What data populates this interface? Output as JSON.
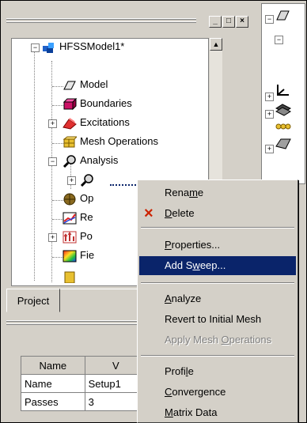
{
  "window": {
    "min_glyph": "_",
    "max_glyph": "□",
    "close_glyph": "×"
  },
  "tree": {
    "root": {
      "label": "HFSSModel1*",
      "icon": "hfss-model-icon",
      "expander": "−"
    },
    "items": [
      {
        "label": "Model",
        "icon": "model-icon"
      },
      {
        "label": "Boundaries",
        "icon": "boundaries-icon"
      },
      {
        "label": "Excitations",
        "icon": "excitations-icon",
        "expander": "+"
      },
      {
        "label": "Mesh Operations",
        "icon": "mesh-operations-icon"
      },
      {
        "label": "Analysis",
        "icon": "analysis-icon",
        "expander": "−"
      },
      {
        "label": "",
        "icon": "setup-icon",
        "expander": "+"
      },
      {
        "label": "Op",
        "icon": "optimetrics-icon"
      },
      {
        "label": "Re",
        "icon": "results-icon"
      },
      {
        "label": "Po",
        "icon": "port-field-icon",
        "expander": "+"
      },
      {
        "label": "Fie",
        "icon": "field-overlays-icon"
      }
    ]
  },
  "tabs": {
    "project": "Project"
  },
  "properties": {
    "headers": [
      "Name",
      "V"
    ],
    "rows": [
      [
        "Name",
        "Setup1"
      ],
      [
        "Passes",
        "3"
      ]
    ]
  },
  "context_menu": {
    "items": [
      {
        "label_pre": "Rena",
        "label_ul": "m",
        "label_post": "e",
        "state": "normal"
      },
      {
        "label_pre": "",
        "label_ul": "D",
        "label_post": "elete",
        "state": "normal",
        "icon": "delete-icon"
      },
      {
        "label_pre": "",
        "label_ul": "P",
        "label_post": "roperties...",
        "state": "normal"
      },
      {
        "label_pre": "Add S",
        "label_ul": "w",
        "label_post": "eep...",
        "state": "selected"
      },
      {
        "label_pre": "",
        "label_ul": "A",
        "label_post": "nalyze",
        "state": "normal"
      },
      {
        "label_pre": "Revert to Initial Mesh",
        "label_ul": "",
        "label_post": "",
        "state": "normal"
      },
      {
        "label_pre": "Apply Mesh ",
        "label_ul": "O",
        "label_post": "perations",
        "state": "disabled"
      },
      {
        "label_pre": "Profi",
        "label_ul": "l",
        "label_post": "e",
        "state": "normal"
      },
      {
        "label_pre": "",
        "label_ul": "C",
        "label_post": "onvergence",
        "state": "normal"
      },
      {
        "label_pre": "",
        "label_ul": "M",
        "label_post": "atrix Data",
        "state": "normal"
      }
    ]
  },
  "colors": {
    "selection": "#0a246a",
    "face": "#d4d0c8",
    "delete_red": "#cc2200"
  }
}
